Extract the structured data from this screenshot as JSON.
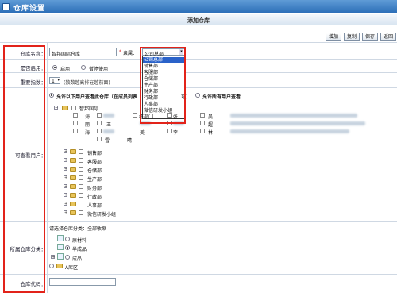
{
  "window": {
    "title": "仓库设置"
  },
  "form": {
    "title": "添加仓库"
  },
  "toolbar": {
    "add": "增加",
    "copy": "复制",
    "save": "保存",
    "back": "返回"
  },
  "fields": {
    "name_label": "仓库名称：",
    "name_value": "智邦国际仓库",
    "belong_label": "隶属：",
    "belong_selected": "公司总部",
    "enabled_label": "是否启用：",
    "enabled_on": "启用",
    "enabled_off": "暂停使用",
    "priority_label": "重要指数：",
    "priority_value": "1",
    "priority_hint": "(数数越高排在越前面)",
    "viewer_label": "可查看用户：",
    "viewer_opt1": "允许以下用户查看此仓库（在成员列表",
    "viewer_opt1b": "可）",
    "viewer_opt2": "允许所有用户查看",
    "category_label": "所属仓库分类：",
    "category_hint": "请选择仓库分类：全部收缩",
    "code_label": "仓库代码："
  },
  "dropdown_options": [
    "公司总部",
    "销售部",
    "客服部",
    "仓储部",
    "生产部",
    "财务部",
    "行政部",
    "人事部",
    "微信研发小组",
    "部门"
  ],
  "tree": {
    "root": "智邦国际",
    "departments": [
      "销售部",
      "客服部",
      "仓储部",
      "生产部",
      "财务部",
      "行政部",
      "人事部",
      "微信研发小组"
    ],
    "visible_members": [
      "海",
      "栋",
      "梅",
      "凌",
      "张",
      "吴",
      "马",
      "涛",
      "丽",
      "王",
      "梅",
      "蕊",
      "超",
      "慧",
      "海",
      "婷",
      "刘",
      "美",
      "崔",
      "梅",
      "李",
      "林",
      "雪",
      "晴"
    ]
  },
  "categories": [
    "原材料",
    "半成品",
    "成品",
    "A库区"
  ]
}
